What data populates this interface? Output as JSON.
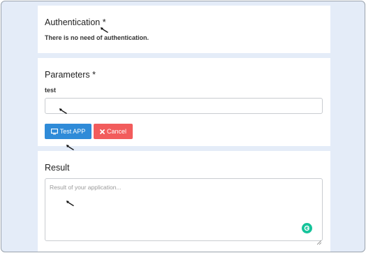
{
  "authentication": {
    "title": "Authentication *",
    "note": "There is no need of authentication."
  },
  "parameters": {
    "title": "Parameters *",
    "field_label": "test",
    "field_value": "",
    "test_button_label": "Test APP",
    "cancel_button_label": "Cancel"
  },
  "result": {
    "title": "Result",
    "placeholder": "Result of your application..."
  },
  "icons": {
    "test_button_icon": "monitor-icon",
    "cancel_button_icon": "x-icon",
    "grammarly_icon": "grammarly-icon",
    "cursor_icon": "mouse-cursor-icon"
  },
  "colors": {
    "background": "#e4ecf8",
    "test_button": "#2f8bd8",
    "cancel_button": "#f25c5c",
    "grammarly": "#15c39a"
  }
}
